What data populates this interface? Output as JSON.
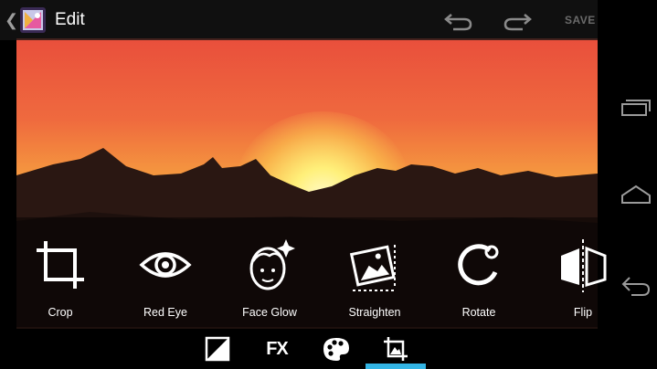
{
  "header": {
    "title": "Edit",
    "save_label": "SAVE"
  },
  "tools": [
    {
      "label": "Crop",
      "icon": "crop-icon"
    },
    {
      "label": "Red Eye",
      "icon": "eye-icon"
    },
    {
      "label": "Face Glow",
      "icon": "face-glow-icon"
    },
    {
      "label": "Straighten",
      "icon": "straighten-icon"
    },
    {
      "label": "Rotate",
      "icon": "rotate-icon"
    },
    {
      "label": "Flip",
      "icon": "flip-icon"
    }
  ],
  "categories": {
    "fx_label": "FX"
  },
  "colors": {
    "accent": "#33b5e5",
    "save_disabled": "#6a6a6a"
  }
}
